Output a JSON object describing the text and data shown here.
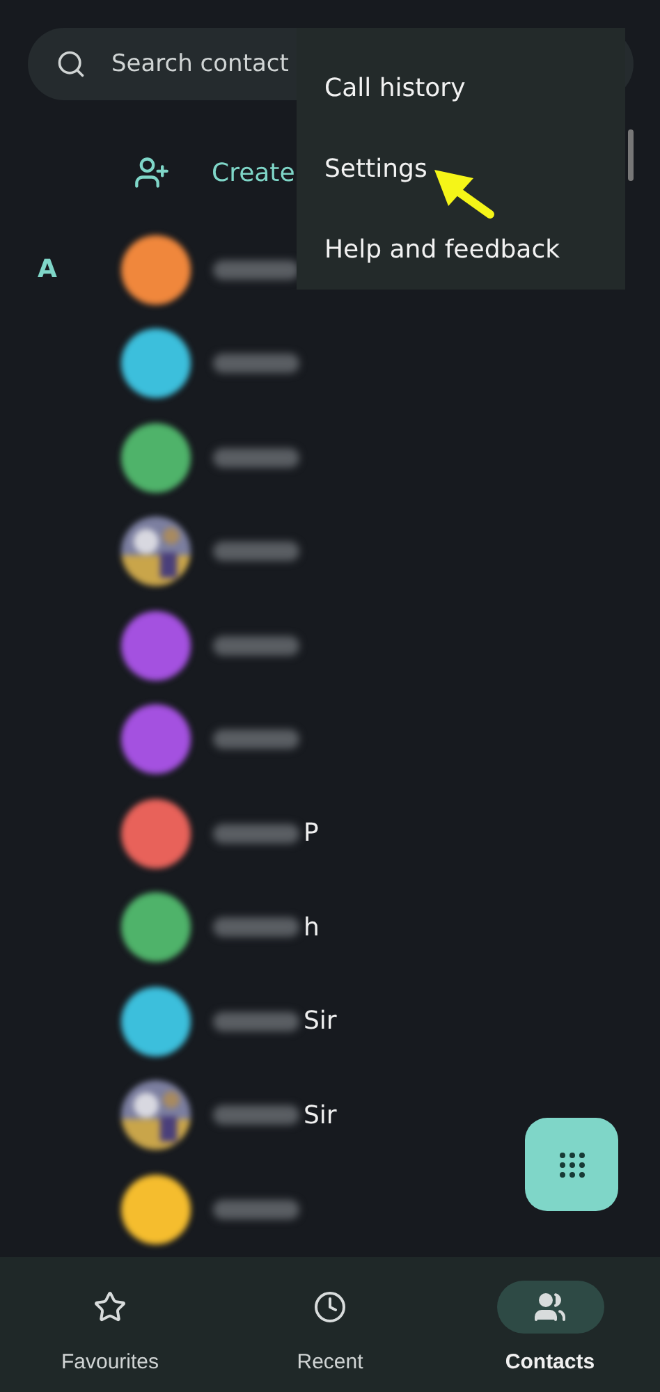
{
  "search": {
    "placeholder": "Search contact"
  },
  "create": {
    "label": "Create"
  },
  "section": {
    "letter": "A"
  },
  "contacts": [
    {
      "kind": "avatar",
      "color": "#f0873c"
    },
    {
      "kind": "avatar",
      "color": "#3cbfdc"
    },
    {
      "kind": "avatar",
      "color": "#4fb36a"
    },
    {
      "kind": "picture"
    },
    {
      "kind": "avatar",
      "color": "#a451e0"
    },
    {
      "kind": "avatar",
      "color": "#a451e0"
    },
    {
      "kind": "avatar",
      "color": "#e8625a",
      "suffix": "P"
    },
    {
      "kind": "avatar",
      "color": "#4fb36a",
      "suffix": "h"
    },
    {
      "kind": "avatar",
      "color": "#3cbfdc",
      "suffix": "Sir"
    },
    {
      "kind": "picture",
      "suffix": "Sir"
    },
    {
      "kind": "avatar",
      "color": "#f5bd2e"
    }
  ],
  "menu": [
    "Call history",
    "Settings",
    "Help and feedback"
  ],
  "nav": [
    {
      "label": "Favourites",
      "selected": false
    },
    {
      "label": "Recent",
      "selected": false
    },
    {
      "label": "Contacts",
      "selected": true
    }
  ]
}
